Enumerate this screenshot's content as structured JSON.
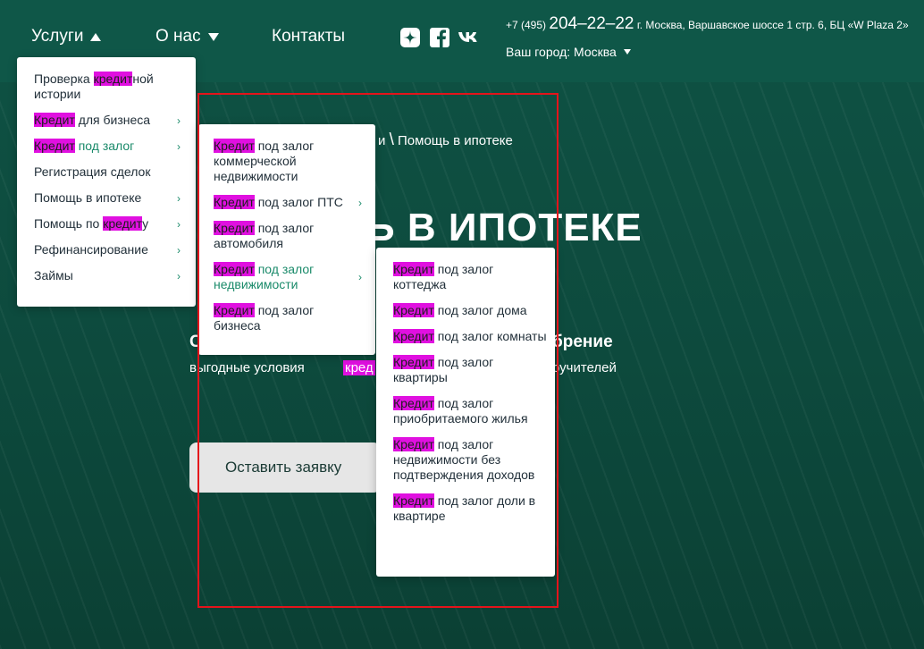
{
  "colors": {
    "header_bg": "#0f5748",
    "accent_green": "#1a8a6a",
    "highlight": "#e010e0",
    "annotation_red": "#e4141b"
  },
  "header": {
    "nav": {
      "services": "Услуги",
      "about": "О нас",
      "contacts": "Контакты"
    },
    "social_icons": [
      "zen-icon",
      "facebook-icon",
      "vk-icon"
    ],
    "phone_prefix": "+7 (495)",
    "phone_number": "204–22–22",
    "address": "г. Москва, Варшавское шоссе 1 стр. 6, БЦ «W Plaza 2»",
    "city_label": "Ваш город: Москва"
  },
  "breadcrumb": {
    "part": "и",
    "separator": "\\",
    "current": "Помощь в ипотеке"
  },
  "hero": {
    "title_fragment": "ь в ипотеке",
    "feature1_head": "С",
    "feature1_text": "выгодные условия",
    "feature2_head": "брение",
    "feature2_text": "ручителей",
    "feature3_text": "кред",
    "cta_label": "Оставить заявку"
  },
  "menu1": {
    "items": [
      {
        "pre": "Проверка ",
        "hl": "кредит",
        "post": "ной истории",
        "arrow": ""
      },
      {
        "pre": "",
        "hl": "Кредит",
        "post": " для бизнеса",
        "arrow": "›"
      },
      {
        "pre": "",
        "hl": "Кредит",
        "post": " под залог",
        "arrow": "›"
      },
      {
        "pre": "Регистрация сделок",
        "hl": "",
        "post": "",
        "arrow": ""
      },
      {
        "pre": "Помощь в ипотеке",
        "hl": "",
        "post": "",
        "arrow": "›"
      },
      {
        "pre": "Помощь по ",
        "hl": "кредит",
        "post": "у",
        "arrow": "›"
      },
      {
        "pre": "Рефинансирование",
        "hl": "",
        "post": "",
        "arrow": "›"
      },
      {
        "pre": "Займы",
        "hl": "",
        "post": "",
        "arrow": "›"
      }
    ]
  },
  "menu2": {
    "items": [
      {
        "hl": "Кредит",
        "post": " под залог коммерческой недвижимости",
        "arrow": ""
      },
      {
        "hl": "Кредит",
        "post": " под залог ПТС",
        "arrow": "›"
      },
      {
        "hl": "Кредит",
        "post": " под залог автомобиля",
        "arrow": ""
      },
      {
        "hl": "Кредит",
        "post": " под залог недвижимости",
        "arrow": "›"
      },
      {
        "hl": "Кредит",
        "post": " под залог бизнеса",
        "arrow": ""
      }
    ]
  },
  "menu3": {
    "items": [
      {
        "hl": "Кредит",
        "post": " под залог коттеджа"
      },
      {
        "hl": "Кредит",
        "post": " под залог дома"
      },
      {
        "hl": "Кредит",
        "post": " под залог комнаты"
      },
      {
        "hl": "Кредит",
        "post": " под залог квартиры"
      },
      {
        "hl": "Кредит",
        "post": " под залог приобритаемого жилья"
      },
      {
        "hl": "Кредит",
        "post": " под залог недвижимости без подтверждения доходов"
      },
      {
        "hl": "Кредит",
        "post": " под залог доли в квартире"
      }
    ]
  }
}
